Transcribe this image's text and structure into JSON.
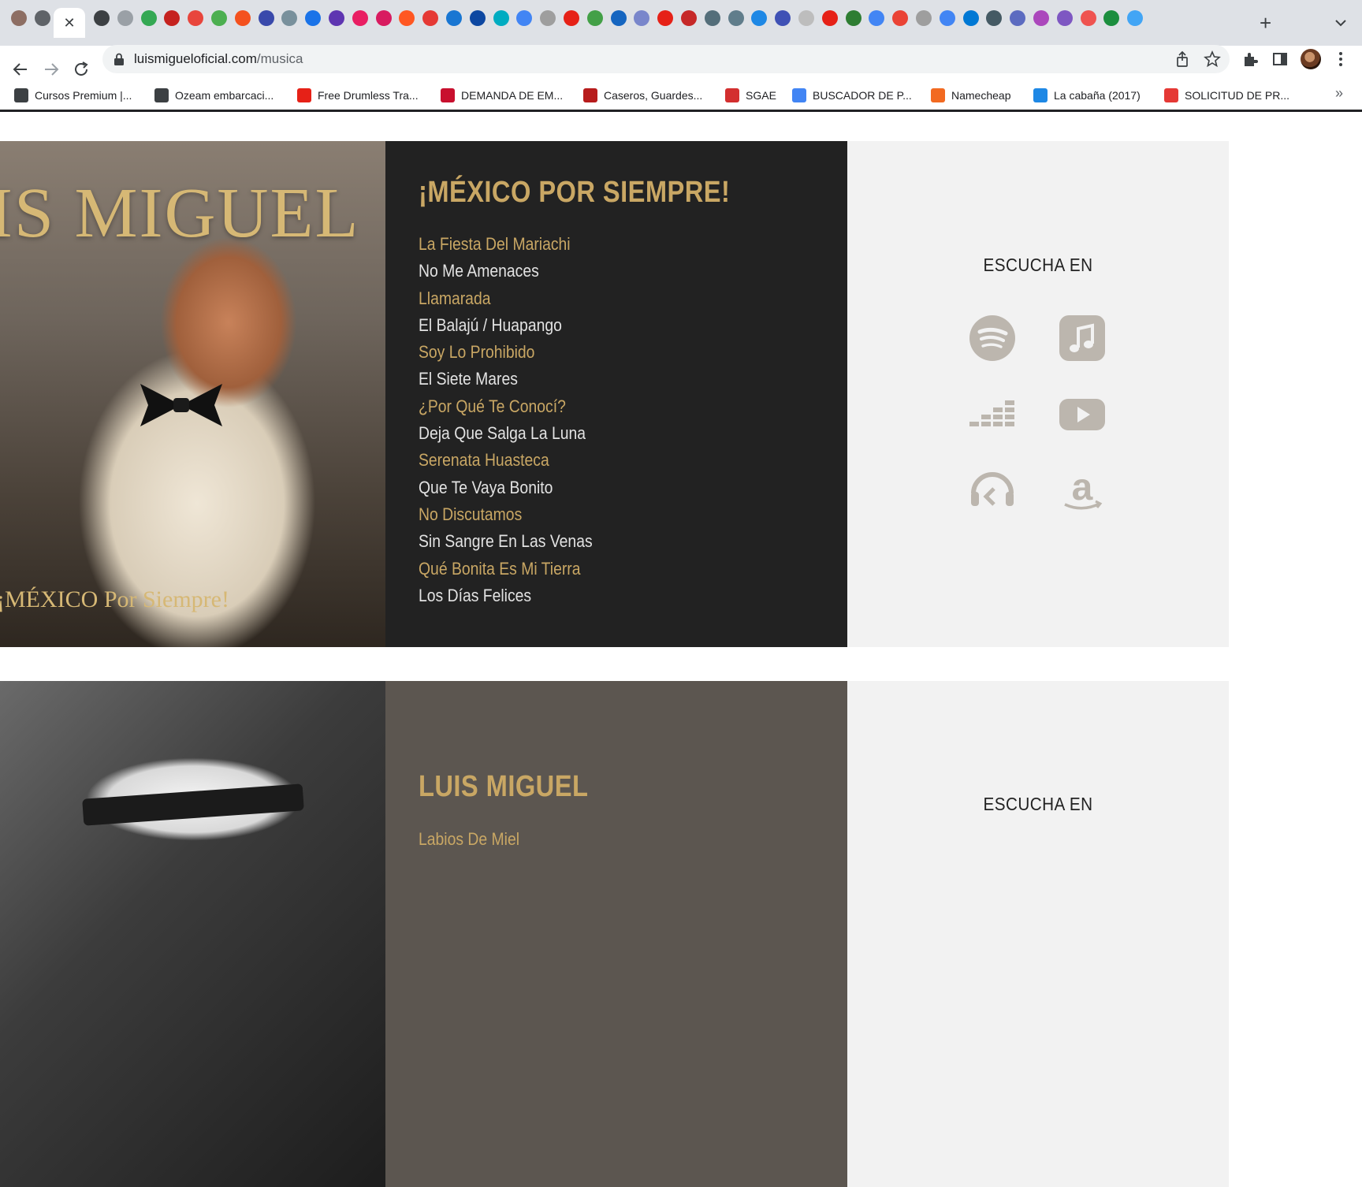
{
  "browser": {
    "tabs_count_hint": "many pinned favicons",
    "active_tab_close": "✕",
    "new_tab": "+",
    "url_host": "luismigueloficial.com",
    "url_path": "/musica"
  },
  "bookmarks": [
    {
      "label": "Cursos Premium |...",
      "icon": "globe-icon",
      "color": "#3c4043"
    },
    {
      "label": "Ozeam embarcaci...",
      "icon": "globe-icon",
      "color": "#3c4043"
    },
    {
      "label": "Free Drumless Tra...",
      "icon": "youtube-icon",
      "color": "#e62117"
    },
    {
      "label": "DEMANDA DE EM...",
      "icon": "job-icon",
      "color": "#c8102e"
    },
    {
      "label": "Caseros, Guardes...",
      "icon": "site-icon",
      "color": "#b71c1c"
    },
    {
      "label": "SGAE",
      "icon": "sgae-icon",
      "color": "#d32f2f"
    },
    {
      "label": "BUSCADOR DE P...",
      "icon": "google-ads-icon",
      "color": "#4285f4"
    },
    {
      "label": "Namecheap",
      "icon": "namecheap-icon",
      "color": "#f26a21"
    },
    {
      "label": "La cabaña (2017)",
      "icon": "film-icon",
      "color": "#1e88e5"
    },
    {
      "label": "SOLICITUD DE PR...",
      "icon": "form-icon",
      "color": "#e53935"
    }
  ],
  "bookmarks_more": "»",
  "albums": [
    {
      "cover_title": "IS MIGUEL",
      "cover_subtitle": "¡MÉXICO Por Siempre!",
      "title": "¡MÉXICO POR SIEMPRE!",
      "tracks": [
        "La Fiesta Del Mariachi",
        "No Me Amenaces",
        "Llamarada",
        "El Balajú / Huapango",
        "Soy Lo Prohibido",
        "El Siete Mares",
        "¿Por Qué Te Conocí?",
        "Deja Que Salga La Luna",
        "Serenata Huasteca",
        "Que Te Vaya Bonito",
        "No Discutamos",
        "Sin Sangre En Las Venas",
        "Qué Bonita Es Mi Tierra",
        "Los Días Felices"
      ],
      "listen_title": "ESCUCHA EN",
      "services": [
        "spotify-icon",
        "apple-music-icon",
        "deezer-icon",
        "youtube-icon",
        "napster-icon",
        "amazon-icon"
      ]
    },
    {
      "title": "LUIS MIGUEL",
      "tracks": [
        "Labios De Miel"
      ],
      "listen_title": "ESCUCHA EN"
    }
  ],
  "colors": {
    "gold": "#c9a764",
    "track_light": "#e2e2e2",
    "panel_dark": "#222222",
    "panel_taupe": "#5c5650",
    "listen_bg": "#f2f2f2",
    "service_icon": "#bcb6ae"
  }
}
